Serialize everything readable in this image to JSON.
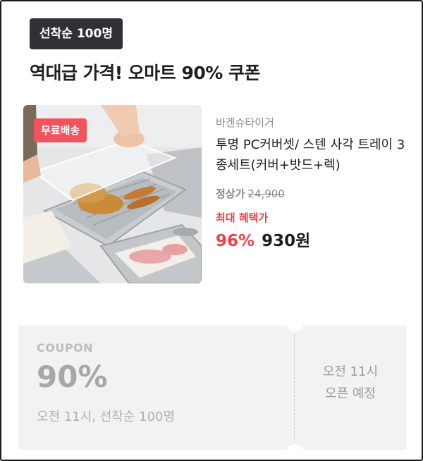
{
  "header": {
    "badge": "선착순 100명",
    "title": "역대급 가격! 오마트 90% 쿠폰"
  },
  "product": {
    "image_badge": "무료배송",
    "image_icon": "photo-product-steel-trays",
    "brand": "바겐슈타이거",
    "name": "투명 PC커버셋/ 스텐 사각 트레이 3종세트(커버+밧드+렉)",
    "list_price_label": "정상가",
    "list_price": "24,900",
    "benefit_label": "최대 혜택가",
    "discount_percent": "96%",
    "final_price": "930원",
    "colors": {
      "accent": "#f0404a",
      "badge_bg": "#2f3136",
      "free_badge_bg": "#f0535b"
    }
  },
  "coupon": {
    "label": "COUPON",
    "value": "90%",
    "description": "오전 11시, 선착순 100명",
    "open_time": "오전 11시",
    "open_status": "오픈 예정",
    "colors": {
      "background": "#f2f2f2",
      "text": "#a7a7a7"
    }
  }
}
